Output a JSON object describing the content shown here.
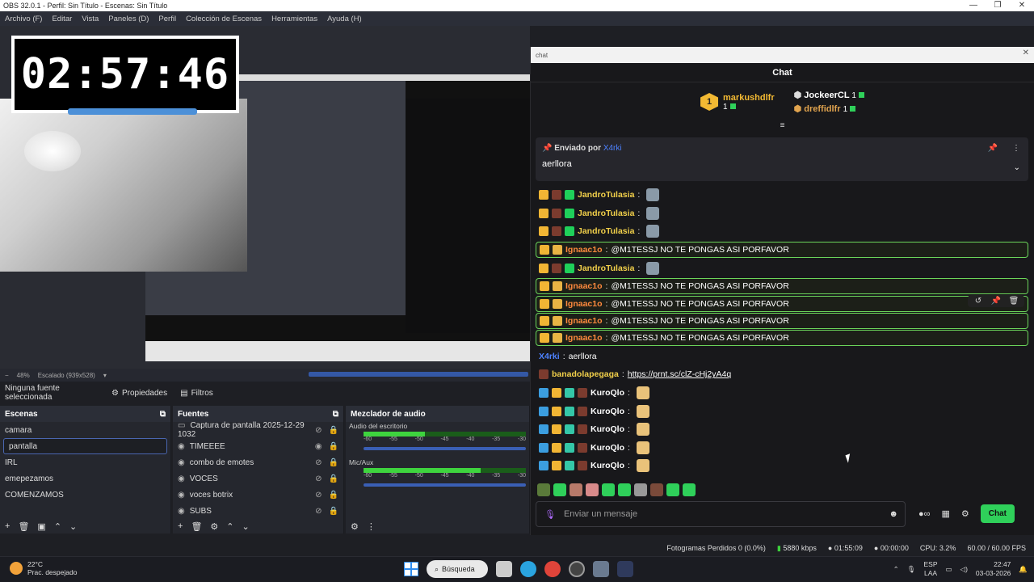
{
  "titlebar": {
    "title": "OBS 32.0.1 - Perfil: Sin Título - Escenas: Sin Título",
    "min": "—",
    "max": "❐",
    "close": "✕"
  },
  "menu": [
    "Archivo (F)",
    "Editar",
    "Vista",
    "Paneles (D)",
    "Perfil",
    "Colección de Escenas",
    "Herramientas",
    "Ayuda (H)"
  ],
  "timer": "02:57:46",
  "zoom": {
    "percent": "48%",
    "scale": "Escalado (939x528)"
  },
  "props": {
    "no_source": "Ninguna fuente seleccionada",
    "properties": "Propiedades",
    "filters": "Filtros"
  },
  "scenes": {
    "title": "Escenas",
    "items": [
      "camara",
      "pantalla",
      "IRL",
      "emepezamos",
      "COMENZAMOS"
    ]
  },
  "sources": {
    "title": "Fuentes",
    "items": [
      "Captura de pantalla 2025-12-29 1032",
      "TIMEEEE",
      "combo de emotes",
      "VOCES",
      "voces botrix",
      "SUBS"
    ]
  },
  "mixer": {
    "title": "Mezclador de audio",
    "channels": [
      {
        "name": "Audio del escritorio",
        "level": 0.38
      },
      {
        "name": "Mic/Aux",
        "level": 0.72
      }
    ],
    "scale": [
      "-60",
      "-55",
      "-50",
      "-45",
      "-40",
      "-35",
      "-30"
    ]
  },
  "status": {
    "frames": "Fotogramas Perdidos 0 (0.0%)",
    "kbps": "5880 kbps",
    "live": "01:55:09",
    "rec": "00:00:00",
    "cpu": "CPU: 3.2%",
    "fps": "60.00 / 60.00 FPS"
  },
  "taskbar": {
    "temp": "22°C",
    "weather": "Prac. despejado",
    "search": "Búsqueda",
    "lang1": "ESP",
    "lang2": "LAA",
    "time": "22:47",
    "date": "03-03-2026"
  },
  "chat": {
    "window_title": "chat",
    "header": "Chat",
    "leaders": [
      {
        "name": "markushdlfr",
        "count": "1"
      },
      {
        "name": "JockeerCL",
        "count": "1"
      },
      {
        "name": "dreffidlfr",
        "count": "1"
      }
    ],
    "leader_rank": "1",
    "pinned": {
      "label": "Enviado por",
      "by": "X4rki",
      "text": "aerllora"
    },
    "messages": [
      {
        "user": "JandroTulasia",
        "text": "",
        "hl": false,
        "color": "yellow"
      },
      {
        "user": "JandroTulasia",
        "text": "",
        "hl": false,
        "color": "yellow"
      },
      {
        "user": "JandroTulasia",
        "text": "",
        "hl": false,
        "color": "yellow"
      },
      {
        "user": "Ignaac1o",
        "text": "@M1TESSJ NO TE PONGAS ASI PORFAVOR",
        "hl": true,
        "color": "orange"
      },
      {
        "user": "JandroTulasia",
        "text": "",
        "hl": false,
        "color": "yellow"
      },
      {
        "user": "Ignaac1o",
        "text": "@M1TESSJ NO TE PONGAS ASI PORFAVOR",
        "hl": true,
        "color": "orange"
      },
      {
        "user": "Ignaac1o",
        "text": "@M1TESSJ NO TE PONGAS ASI PORFAVOR",
        "hl": true,
        "color": "orange"
      },
      {
        "user": "Ignaac1o",
        "text": "@M1TESSJ NO TE PONGAS ASI PORFAVOR",
        "hl": true,
        "color": "orange"
      },
      {
        "user": "Ignaac1o",
        "text": "@M1TESSJ NO TE PONGAS ASI PORFAVOR",
        "hl": true,
        "color": "orange"
      },
      {
        "user": "X4rki",
        "text": "aerllora",
        "hl": false,
        "color": "blue"
      },
      {
        "user": "banadolapegaga",
        "text": "https://prnt.sc/clZ-cHj2yA4q",
        "hl": false,
        "color": "yellow"
      },
      {
        "user": "KuroQlo",
        "text": "",
        "hl": false,
        "color": "white"
      },
      {
        "user": "KuroQlo",
        "text": "",
        "hl": false,
        "color": "white"
      },
      {
        "user": "KuroQlo",
        "text": "",
        "hl": false,
        "color": "white"
      },
      {
        "user": "KuroQlo",
        "text": "",
        "hl": false,
        "color": "white"
      },
      {
        "user": "KuroQlo",
        "text": "",
        "hl": false,
        "color": "white"
      }
    ],
    "input_placeholder": "Enviar un mensaje",
    "send": "Chat"
  }
}
